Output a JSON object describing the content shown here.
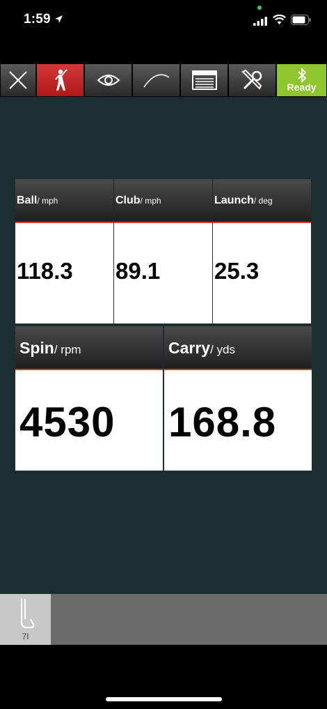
{
  "status": {
    "time": "1:59"
  },
  "toolbar": {
    "items": [
      {
        "icon": "close-icon"
      },
      {
        "icon": "golfer-icon",
        "active": true
      },
      {
        "icon": "eye-icon"
      },
      {
        "icon": "trajectory-icon"
      },
      {
        "icon": "table-icon"
      },
      {
        "icon": "tools-icon"
      },
      {
        "icon": "bluetooth-icon",
        "label": "Ready"
      }
    ],
    "ready_label": "Ready"
  },
  "metrics": {
    "ball": {
      "label": "Ball",
      "unit": "/ mph",
      "value": "118.3"
    },
    "club": {
      "label": "Club",
      "unit": "/ mph",
      "value": "89.1"
    },
    "launch": {
      "label": "Launch",
      "unit": "/ deg",
      "value": "25.3"
    },
    "spin": {
      "label": "Spin",
      "unit": "/ rpm",
      "value": "4530"
    },
    "carry": {
      "label": "Carry",
      "unit": "/ yds",
      "value": "168.8"
    }
  },
  "club_selector": {
    "label": "7I"
  },
  "colors": {
    "background": "#1b2f33",
    "accent_red": "#d83a2b",
    "ready_green": "#8fc52e"
  }
}
